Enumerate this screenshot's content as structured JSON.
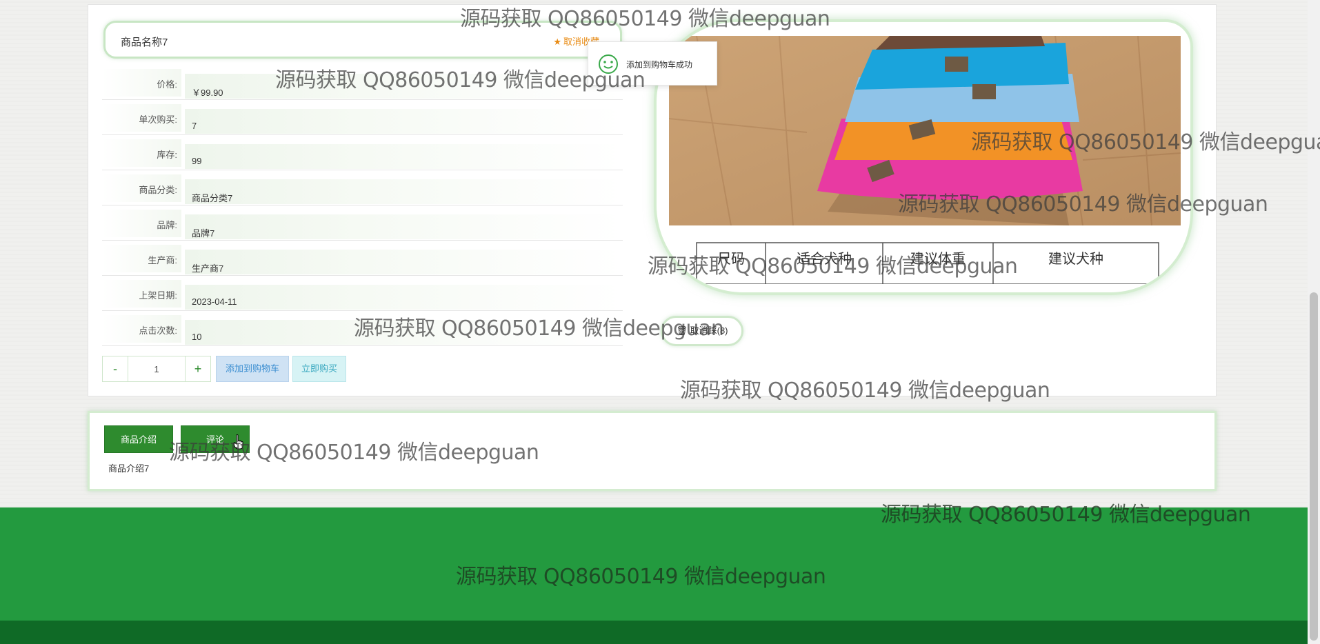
{
  "product": {
    "name": "商品名称7",
    "favorite_label": "取消收藏",
    "attributes": [
      {
        "label": "价格:",
        "value": "￥99.90"
      },
      {
        "label": "单次购买:",
        "value": "7"
      },
      {
        "label": "库存:",
        "value": "99"
      },
      {
        "label": "商品分类:",
        "value": "商品分类7"
      },
      {
        "label": "品牌:",
        "value": "品牌7"
      },
      {
        "label": "生产商:",
        "value": "生产商7"
      },
      {
        "label": "上架日期:",
        "value": "2023-04-11"
      },
      {
        "label": "点击次数:",
        "value": "10"
      }
    ],
    "quantity": "1",
    "minus_label": "-",
    "plus_label": "+",
    "add_to_cart_label": "添加到购物车",
    "buy_now_label": "立即购买",
    "cancel_label": "取消踩(8)"
  },
  "toast": {
    "message": "添加到购物车成功"
  },
  "image_table": {
    "headers": [
      "尺码",
      "适合犬种",
      "建议体重",
      "建议犬种"
    ]
  },
  "tabs": [
    {
      "label": "商品介绍"
    },
    {
      "label": "评论"
    }
  ],
  "intro": {
    "text": "商品介绍7"
  },
  "watermark": {
    "text": "源码获取 QQ86050149 微信deepguan",
    "text_cut": "源码获取 QQ86050149 微信deepgua"
  },
  "colors": {
    "accent_green": "#2e8b2e",
    "footer_green": "#239a3f",
    "footer_dark": "#0f6a26",
    "favorite_orange": "#e88a12",
    "cart_blue": "#3d8fd1"
  }
}
